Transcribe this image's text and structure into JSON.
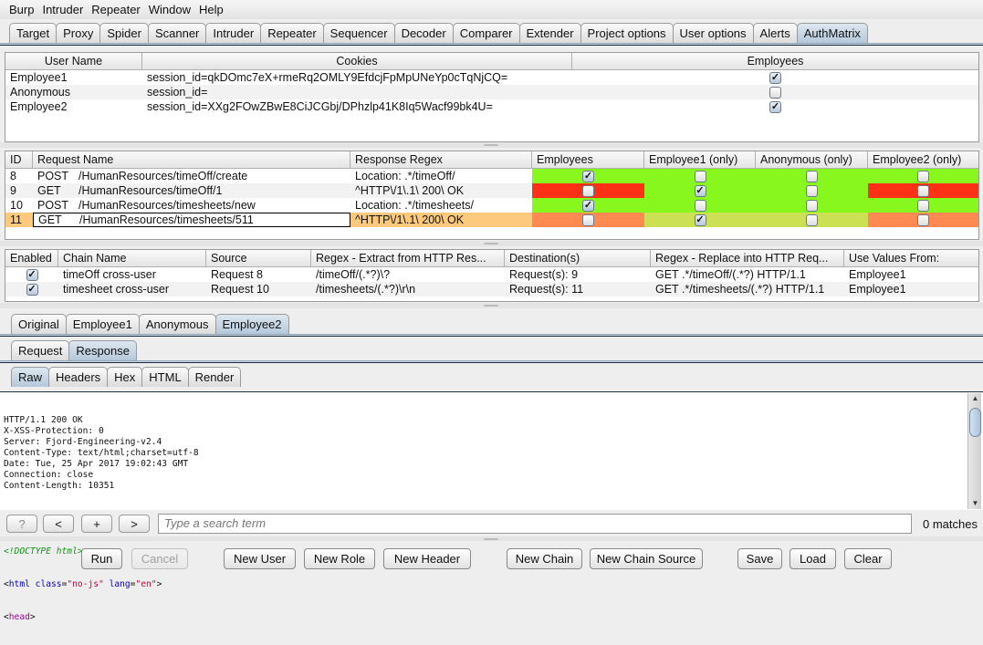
{
  "menu": [
    "Burp",
    "Intruder",
    "Repeater",
    "Window",
    "Help"
  ],
  "main_tabs": [
    {
      "label": "Target",
      "active": false
    },
    {
      "label": "Proxy",
      "active": false
    },
    {
      "label": "Spider",
      "active": false
    },
    {
      "label": "Scanner",
      "active": false
    },
    {
      "label": "Intruder",
      "active": false
    },
    {
      "label": "Repeater",
      "active": false
    },
    {
      "label": "Sequencer",
      "active": false
    },
    {
      "label": "Decoder",
      "active": false
    },
    {
      "label": "Comparer",
      "active": false
    },
    {
      "label": "Extender",
      "active": false
    },
    {
      "label": "Project options",
      "active": false
    },
    {
      "label": "User options",
      "active": false
    },
    {
      "label": "Alerts",
      "active": false
    },
    {
      "label": "AuthMatrix",
      "active": true
    }
  ],
  "users_table": {
    "headers": [
      "User Name",
      "Cookies",
      "Employees"
    ],
    "rows": [
      {
        "user": "Employee1",
        "cookies": "session_id=qkDOmc7eX+rmeRq2OMLY9EfdcjFpMpUNeYp0cTqNjCQ=",
        "employees": true
      },
      {
        "user": "Anonymous",
        "cookies": "session_id=",
        "employees": false
      },
      {
        "user": "Employee2",
        "cookies": "session_id=XXg2FOwZBwE8CiJCGbj/DPhzlp41K8Iq5Wacf99bk4U=",
        "employees": true
      }
    ]
  },
  "requests_table": {
    "headers": [
      "ID",
      "Request Name",
      "Response Regex",
      "Employees",
      "Employee1 (only)",
      "Anonymous (only)",
      "Employee2 (only)"
    ],
    "rows": [
      {
        "id": "8",
        "method": "POST",
        "path": "/HumanResources/timeOff/create",
        "regex": "Location: .*/timeOff/",
        "checks": [
          true,
          false,
          false,
          false
        ],
        "colors": [
          "#87f71d",
          "#87f71d",
          "#87f71d",
          "#87f71d"
        ],
        "selected": false
      },
      {
        "id": "9",
        "method": "GET",
        "path": "/HumanResources/timeOff/1",
        "regex": "^HTTP\\/1\\.1\\ 200\\ OK",
        "checks": [
          false,
          true,
          false,
          false
        ],
        "colors": [
          "#fe3016",
          "#87f71d",
          "#87f71d",
          "#fe3016"
        ],
        "selected": false
      },
      {
        "id": "10",
        "method": "POST",
        "path": "/HumanResources/timesheets/new",
        "regex": "Location: .*/timesheets/",
        "checks": [
          true,
          false,
          false,
          false
        ],
        "colors": [
          "#87f71d",
          "#87f71d",
          "#87f71d",
          "#87f71d"
        ],
        "selected": false
      },
      {
        "id": "11",
        "method": "GET",
        "path": "/HumanResources/timesheets/511",
        "regex": "^HTTP\\/1\\.1\\ 200\\ OK",
        "checks": [
          false,
          true,
          false,
          false
        ],
        "colors": [
          "#fe8a52",
          "#cbe052",
          "#cbe052",
          "#fe8a52"
        ],
        "selected": true
      }
    ]
  },
  "chains_table": {
    "headers": [
      "Enabled",
      "Chain Name",
      "Source",
      "Regex - Extract from HTTP Res...",
      "Destination(s)",
      "Regex - Replace into HTTP Req...",
      "Use Values From:"
    ],
    "rows": [
      {
        "enabled": true,
        "name": "timeOff cross-user",
        "source": "Request 8",
        "extract": "/timeOff/(.*?)\\?",
        "dest": "Request(s): 9",
        "replace": "GET .*/timeOff/(.*?) HTTP/1.1",
        "use_from": "Employee1"
      },
      {
        "enabled": true,
        "name": "timesheet cross-user",
        "source": "Request 10",
        "extract": "/timesheets/(.*?)\\r\\n",
        "dest": "Request(s): 11",
        "replace": "GET .*/timesheets/(.*?) HTTP/1.1",
        "use_from": "Employee1"
      }
    ]
  },
  "user_tabs": [
    {
      "label": "Original",
      "active": false
    },
    {
      "label": "Employee1",
      "active": false
    },
    {
      "label": "Anonymous",
      "active": false
    },
    {
      "label": "Employee2",
      "active": true
    }
  ],
  "reqresp_tabs": [
    {
      "label": "Request",
      "active": false
    },
    {
      "label": "Response",
      "active": true
    }
  ],
  "view_tabs": [
    {
      "label": "Raw",
      "active": true
    },
    {
      "label": "Headers",
      "active": false
    },
    {
      "label": "Hex",
      "active": false
    },
    {
      "label": "HTML",
      "active": false
    },
    {
      "label": "Render",
      "active": false
    }
  ],
  "response_headers": [
    "HTTP/1.1 200 OK",
    "X-XSS-Protection: 0",
    "Server: Fjord-Engineering-v2.4",
    "Content-Type: text/html;charset=utf-8",
    "Date: Tue, 25 Apr 2017 19:02:43 GMT",
    "Connection: close",
    "Content-Length: 10351"
  ],
  "response_body": {
    "doctype": "<!DOCTYPE html>",
    "html_tag": "html",
    "attr1_name": "class",
    "attr1_value": "\"no-js\"",
    "attr2_name": "lang",
    "attr2_value": "\"en\"",
    "head_tag": "head"
  },
  "search": {
    "help": "?",
    "prev": "<",
    "add": "+",
    "next": ">",
    "placeholder": "Type a search term",
    "matches": "0 matches"
  },
  "buttons": {
    "run": "Run",
    "cancel": "Cancel",
    "new_user": "New User",
    "new_role": "New Role",
    "new_header": "New Header",
    "new_chain": "New Chain",
    "new_chain_source": "New Chain Source",
    "save": "Save",
    "load": "Load",
    "clear": "Clear"
  }
}
